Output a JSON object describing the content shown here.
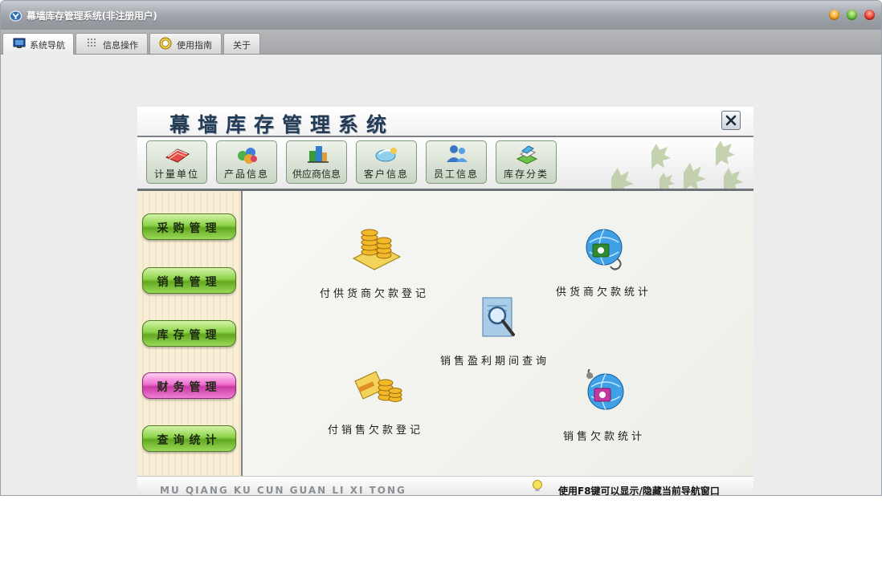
{
  "window": {
    "title": "幕墙库存管理系统(非注册用户)"
  },
  "tabs": [
    {
      "label": "系统导航"
    },
    {
      "label": "信息操作"
    },
    {
      "label": "使用指南"
    },
    {
      "label": "关于"
    }
  ],
  "panel": {
    "title": "幕墙库存管理系统"
  },
  "toolbar": [
    {
      "label": "计量单位",
      "icon": "book-icon"
    },
    {
      "label": "产品信息",
      "icon": "products-icon"
    },
    {
      "label": "供应商信息",
      "icon": "supplier-icon"
    },
    {
      "label": "客户信息",
      "icon": "customer-icon"
    },
    {
      "label": "员工信息",
      "icon": "staff-icon"
    },
    {
      "label": "库存分类",
      "icon": "inventory-icon"
    }
  ],
  "sidebar": [
    {
      "label": "采购管理"
    },
    {
      "label": "销售管理"
    },
    {
      "label": "库存管理"
    },
    {
      "label": "财务管理",
      "active": true
    },
    {
      "label": "查询统计"
    }
  ],
  "functions": [
    {
      "label": "付供货商欠款登记",
      "icon": "coins-icon"
    },
    {
      "label": "供货商欠款统计",
      "icon": "globe-cd-icon"
    },
    {
      "label": "销售盈利期间查询",
      "icon": "magnifier-document-icon"
    },
    {
      "label": "付销售欠款登记",
      "icon": "coins-card-icon"
    },
    {
      "label": "销售欠款统计",
      "icon": "globe-cd-icon"
    }
  ],
  "footer": {
    "left": "MU QIANG KU CUN  GUAN LI XI TONG",
    "right": "使用F8键可以显示/隐藏当前导航窗口"
  },
  "colors": {
    "sidebar_button": "#8bd247",
    "sidebar_button_active": "#f06ed0",
    "toolbar_button": "#c9d5c4",
    "title_text": "#243b55"
  }
}
